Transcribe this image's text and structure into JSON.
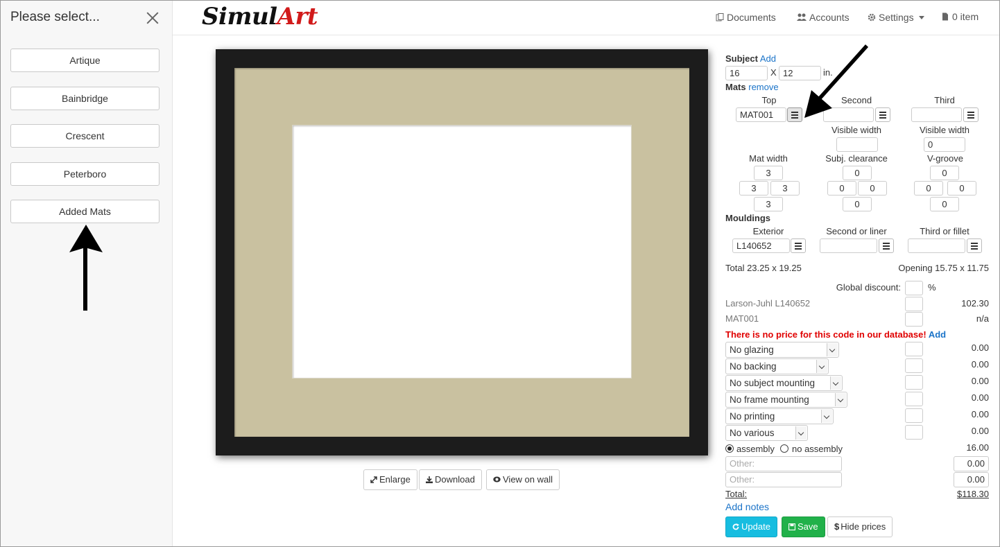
{
  "sidebar": {
    "title": "Please select...",
    "items": [
      "Artique",
      "Bainbridge",
      "Crescent",
      "Peterboro",
      "Added Mats"
    ]
  },
  "brand": {
    "part1": "Simul",
    "part2": "Art"
  },
  "nav": {
    "documents": "Documents",
    "accounts": "Accounts",
    "settings": "Settings",
    "cart": "0 item"
  },
  "preview_buttons": {
    "enlarge": "Enlarge",
    "download": "Download",
    "view_on_wall": "View on wall"
  },
  "subject": {
    "label": "Subject",
    "add": "Add",
    "width": "16",
    "x": "X",
    "height": "12",
    "unit": "in."
  },
  "mats": {
    "label": "Mats",
    "remove": "remove",
    "columns": [
      "Top",
      "Second",
      "Third"
    ],
    "top_code": "MAT001",
    "second_code": "",
    "third_code": "",
    "visible_width_label": "Visible width",
    "second_visible": "",
    "third_visible": "0",
    "mat_width_label": "Mat width",
    "subj_clearance_label": "Subj. clearance",
    "vgroove_label": "V-groove",
    "mat_width": {
      "top": "3",
      "left": "3",
      "right": "3",
      "bottom": "3"
    },
    "clearance": {
      "top": "0",
      "left": "0",
      "right": "0",
      "bottom": "0"
    },
    "vgroove": {
      "top": "0",
      "left": "0",
      "right": "0",
      "bottom": "0"
    }
  },
  "mouldings": {
    "label": "Mouldings",
    "columns": [
      "Exterior",
      "Second or liner",
      "Third or fillet"
    ],
    "exterior_code": "L140652",
    "second_code": "",
    "third_code": ""
  },
  "totals": {
    "total": "Total 23.25 x 19.25",
    "opening": "Opening 15.75 x 11.75"
  },
  "pricing": {
    "global_discount_label": "Global discount:",
    "percent": "%",
    "lines": [
      {
        "label": "Larson-Juhl L140652",
        "price": "102.30"
      },
      {
        "label": "MAT001",
        "price": "n/a"
      }
    ],
    "warning": "There is no price for this code in our database!",
    "warning_add": "Add",
    "selects": [
      {
        "label": "No glazing",
        "price": "0.00"
      },
      {
        "label": "No backing",
        "price": "0.00"
      },
      {
        "label": "No subject mounting",
        "price": "0.00"
      },
      {
        "label": "No frame mounting",
        "price": "0.00"
      },
      {
        "label": "No printing",
        "price": "0.00"
      },
      {
        "label": "No various",
        "price": "0.00"
      }
    ],
    "assembly": "assembly",
    "no_assembly": "no assembly",
    "assembly_price": "16.00",
    "other_placeholder": "Other:",
    "other1_price": "0.00",
    "other2_price": "0.00",
    "total_label": "Total:",
    "total_value": "$118.30",
    "add_notes": "Add notes"
  },
  "actions": {
    "update": "Update",
    "save": "Save",
    "hide_prices": "Hide prices"
  },
  "colors": {
    "accent": "#1a73c8",
    "brand_red": "#d11a1a",
    "update": "#17bde0",
    "save": "#21b14a",
    "mat": "#c9c1a0",
    "frame": "#1c1c1c"
  }
}
